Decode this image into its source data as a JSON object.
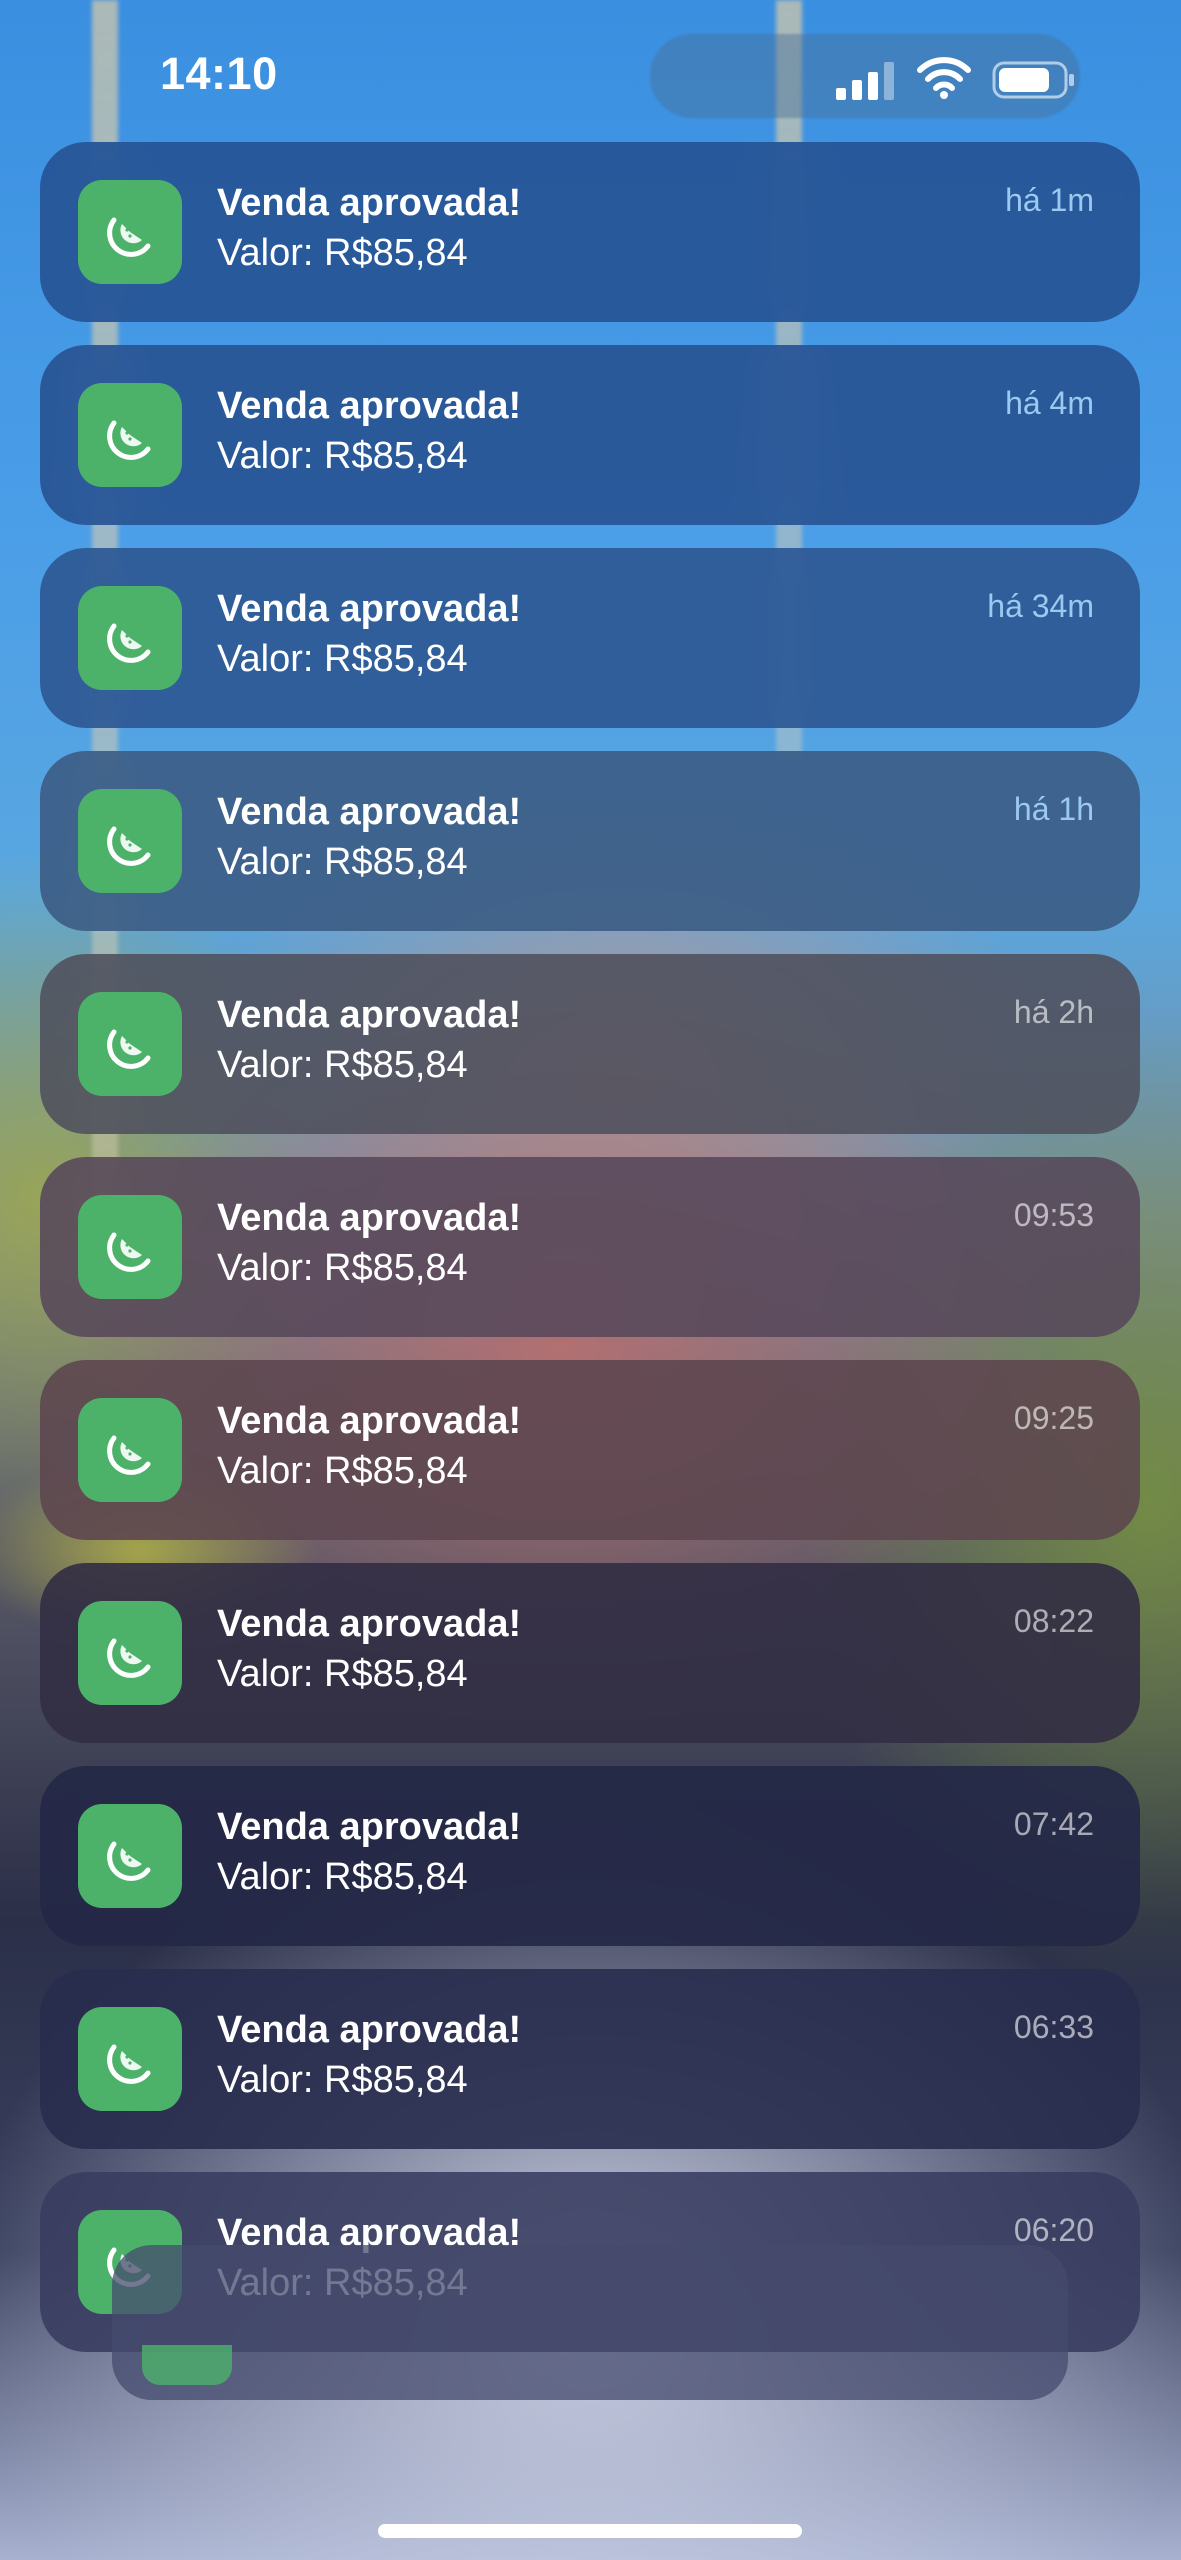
{
  "status_bar": {
    "time": "14:10",
    "signal_icon": "cellular-signal-icon",
    "wifi_icon": "wifi-icon",
    "battery_icon": "battery-icon",
    "battery_level": 0.8
  },
  "app": {
    "icon": "watermelon-slice-icon",
    "icon_color": "#4cb26a"
  },
  "notifications": [
    {
      "title": "Venda aprovada!",
      "body": "Valor: R$85,84",
      "time": "há 1m"
    },
    {
      "title": "Venda aprovada!",
      "body": "Valor: R$85,84",
      "time": "há 4m"
    },
    {
      "title": "Venda aprovada!",
      "body": "Valor: R$85,84",
      "time": "há 34m"
    },
    {
      "title": "Venda aprovada!",
      "body": "Valor: R$85,84",
      "time": "há 1h"
    },
    {
      "title": "Venda aprovada!",
      "body": "Valor: R$85,84",
      "time": "há 2h"
    },
    {
      "title": "Venda aprovada!",
      "body": "Valor: R$85,84",
      "time": "09:53"
    },
    {
      "title": "Venda aprovada!",
      "body": "Valor: R$85,84",
      "time": "09:25"
    },
    {
      "title": "Venda aprovada!",
      "body": "Valor: R$85,84",
      "time": "08:22"
    },
    {
      "title": "Venda aprovada!",
      "body": "Valor: R$85,84",
      "time": "07:42"
    },
    {
      "title": "Venda aprovada!",
      "body": "Valor: R$85,84",
      "time": "06:33"
    },
    {
      "title": "Venda aprovada!",
      "body": "Valor: R$85,84",
      "time": "06:20"
    }
  ]
}
